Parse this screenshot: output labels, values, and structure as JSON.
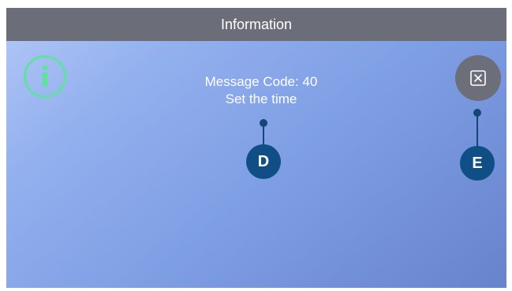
{
  "window": {
    "title": "Information"
  },
  "message": {
    "line1": "Message Code: 40",
    "line2": "Set the time"
  },
  "callouts": [
    {
      "label": "D"
    },
    {
      "label": "E"
    }
  ],
  "icons": {
    "info": "info-icon",
    "close": "close-icon"
  },
  "colors": {
    "titlebar": "#6b6d78",
    "info_ring": "#61e0a1",
    "close_button": "#6c6e79",
    "callout_badge": "#0f4f86",
    "gradient_start": "#b2c8f7",
    "gradient_end": "#6783cc"
  }
}
